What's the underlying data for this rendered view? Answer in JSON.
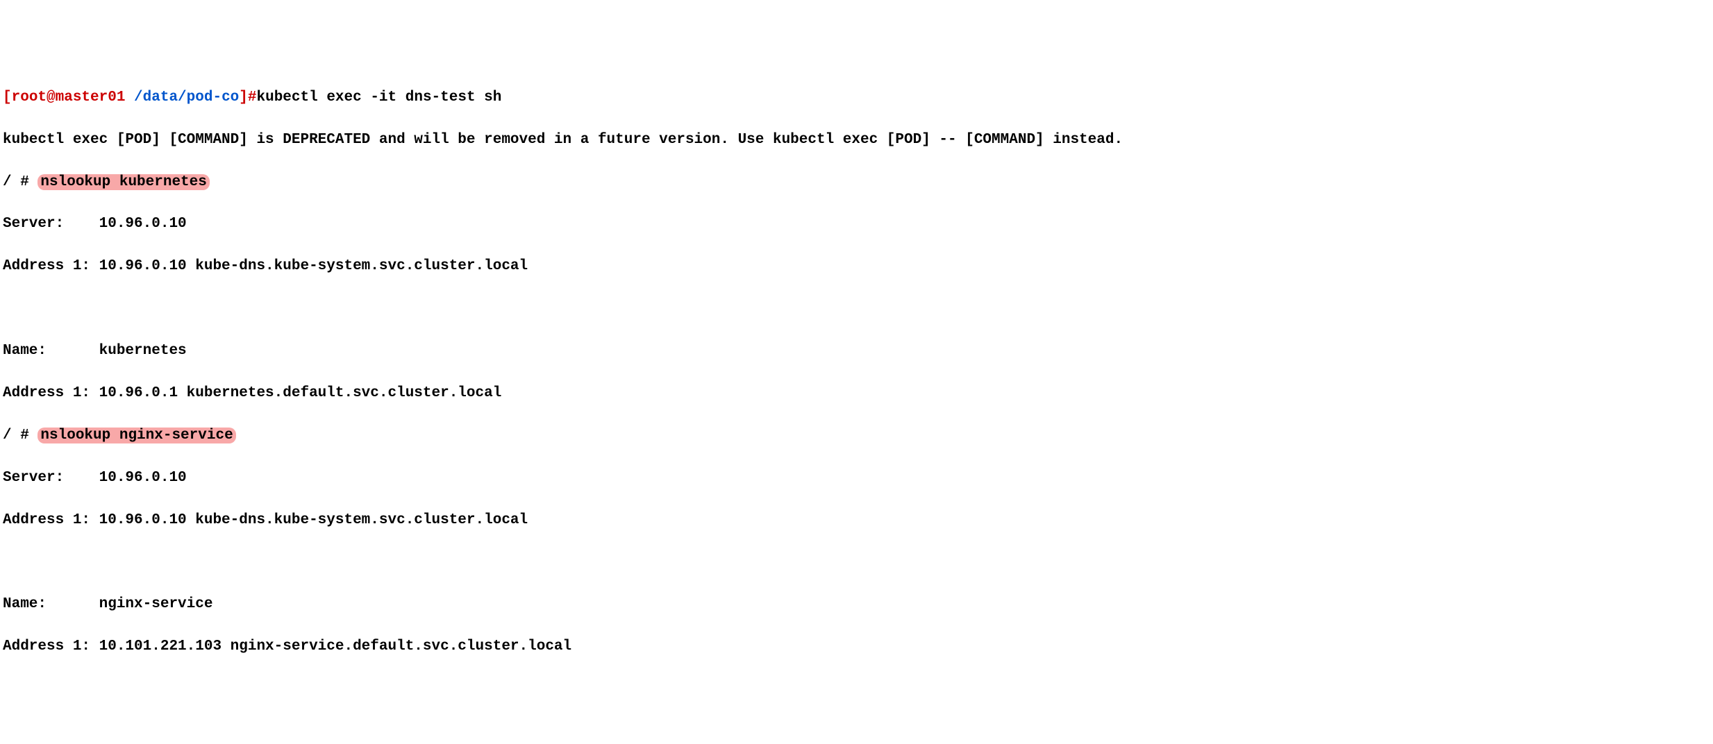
{
  "prompt1": {
    "bracket_open": "[",
    "user": "root@master01",
    "space": " ",
    "path": "/data/pod-co",
    "bracket_close": "]",
    "hash": "#",
    "command": "kubectl exec -it dns-test sh"
  },
  "deprecation": "kubectl exec [POD] [COMMAND] is DEPRECATED and will be removed in a future version. Use kubectl exec [POD] -- [COMMAND] instead.",
  "shell1": {
    "prefix": "/ # ",
    "cmd": "nslookup kubernetes"
  },
  "out1_server": "Server:    10.96.0.10",
  "out1_addr": "Address 1: 10.96.0.10 kube-dns.kube-system.svc.cluster.local",
  "blank1": " ",
  "out1_name": "Name:      kubernetes",
  "out1_addr2": "Address 1: 10.96.0.1 kubernetes.default.svc.cluster.local",
  "shell2": {
    "prefix": "/ # ",
    "cmd": "nslookup nginx-service"
  },
  "out2_server": "Server:    10.96.0.10",
  "out2_addr": "Address 1: 10.96.0.10 kube-dns.kube-system.svc.cluster.local",
  "blank2": " ",
  "out2_name": "Name:      nginx-service",
  "out2_addr2": "Address 1: 10.101.221.103 nginx-service.default.svc.cluster.local"
}
